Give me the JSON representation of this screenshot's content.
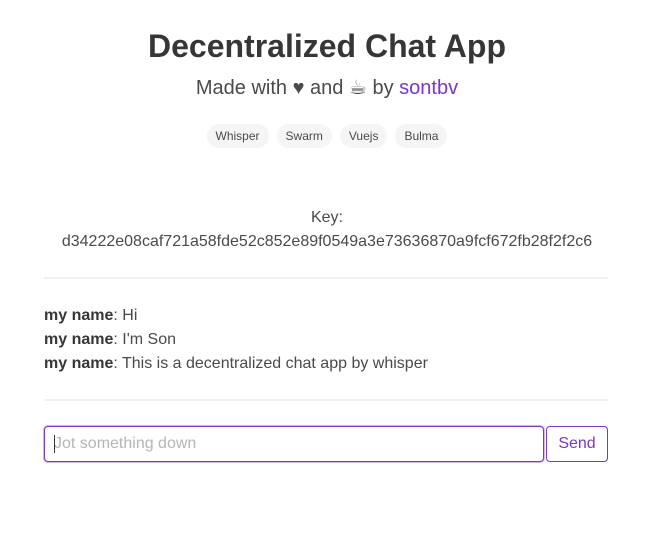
{
  "header": {
    "title": "Decentralized Chat App",
    "subtitle": {
      "made_with": "Made with",
      "heart": "♥",
      "and": "and",
      "coffee": "☕",
      "by": "by",
      "author": "sontbv"
    },
    "tags": [
      "Whisper",
      "Swarm",
      "Vuejs",
      "Bulma"
    ]
  },
  "key": {
    "label": "Key:",
    "value": "d34222e08caf721a58fde52c852e89f0549a3e73636870a9fcf672fb28f2f2c6"
  },
  "messages": [
    {
      "name": "my name",
      "text": ": Hi"
    },
    {
      "name": "my name",
      "text": ": I'm Son"
    },
    {
      "name": "my name",
      "text": ": This is a decentralized chat app by whisper"
    }
  ],
  "composer": {
    "placeholder": "Jot something down",
    "value": "",
    "send_label": "Send"
  },
  "colors": {
    "accent": "#7b35c9",
    "tag_background": "#f5f5f5",
    "text": "#4a4a4a"
  }
}
